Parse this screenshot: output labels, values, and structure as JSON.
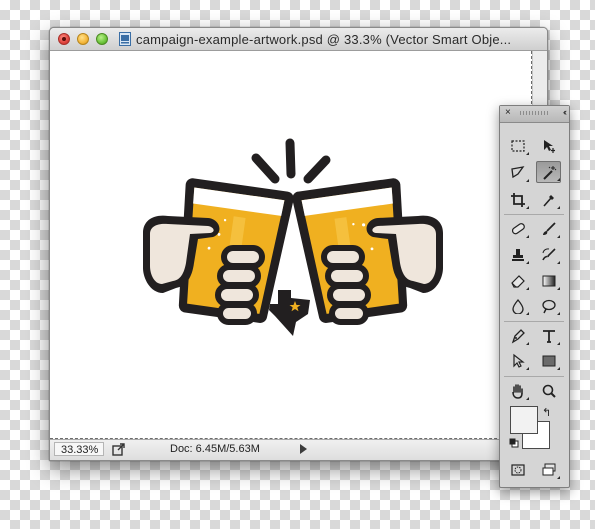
{
  "window": {
    "title": "campaign-example-artwork.psd @ 33.3% (Vector Smart Obje...",
    "buttons": [
      "close",
      "minimize",
      "zoom"
    ]
  },
  "statusbar": {
    "zoom": "33.33%",
    "doc_size": "Doc: 6.45M/5.63M"
  },
  "artwork": {
    "subject": "two beer mugs toasting",
    "colors": {
      "beer": "#f0b020",
      "outline": "#221f20",
      "foam": "#ffffff",
      "skin": "#efe6dc",
      "star": "#f0b020"
    }
  },
  "tools_panel": {
    "close": "×",
    "collapse": "‹‹",
    "tools": [
      "rectangular-marquee-icon",
      "move-icon",
      "lasso-icon",
      "magic-wand-icon",
      "crop-icon",
      "eyedropper-icon",
      "healing-brush-icon",
      "brush-icon",
      "clone-stamp-icon",
      "history-brush-icon",
      "eraser-icon",
      "gradient-icon",
      "blur-icon",
      "dodge-icon",
      "pen-icon",
      "type-icon",
      "path-selection-icon",
      "rectangle-icon",
      "hand-icon",
      "zoom-icon"
    ],
    "active_tool": "magic-wand-icon",
    "swap_symbol": "↰",
    "foreground_color": "#f2f2f2",
    "background_color": "#ffffff"
  }
}
